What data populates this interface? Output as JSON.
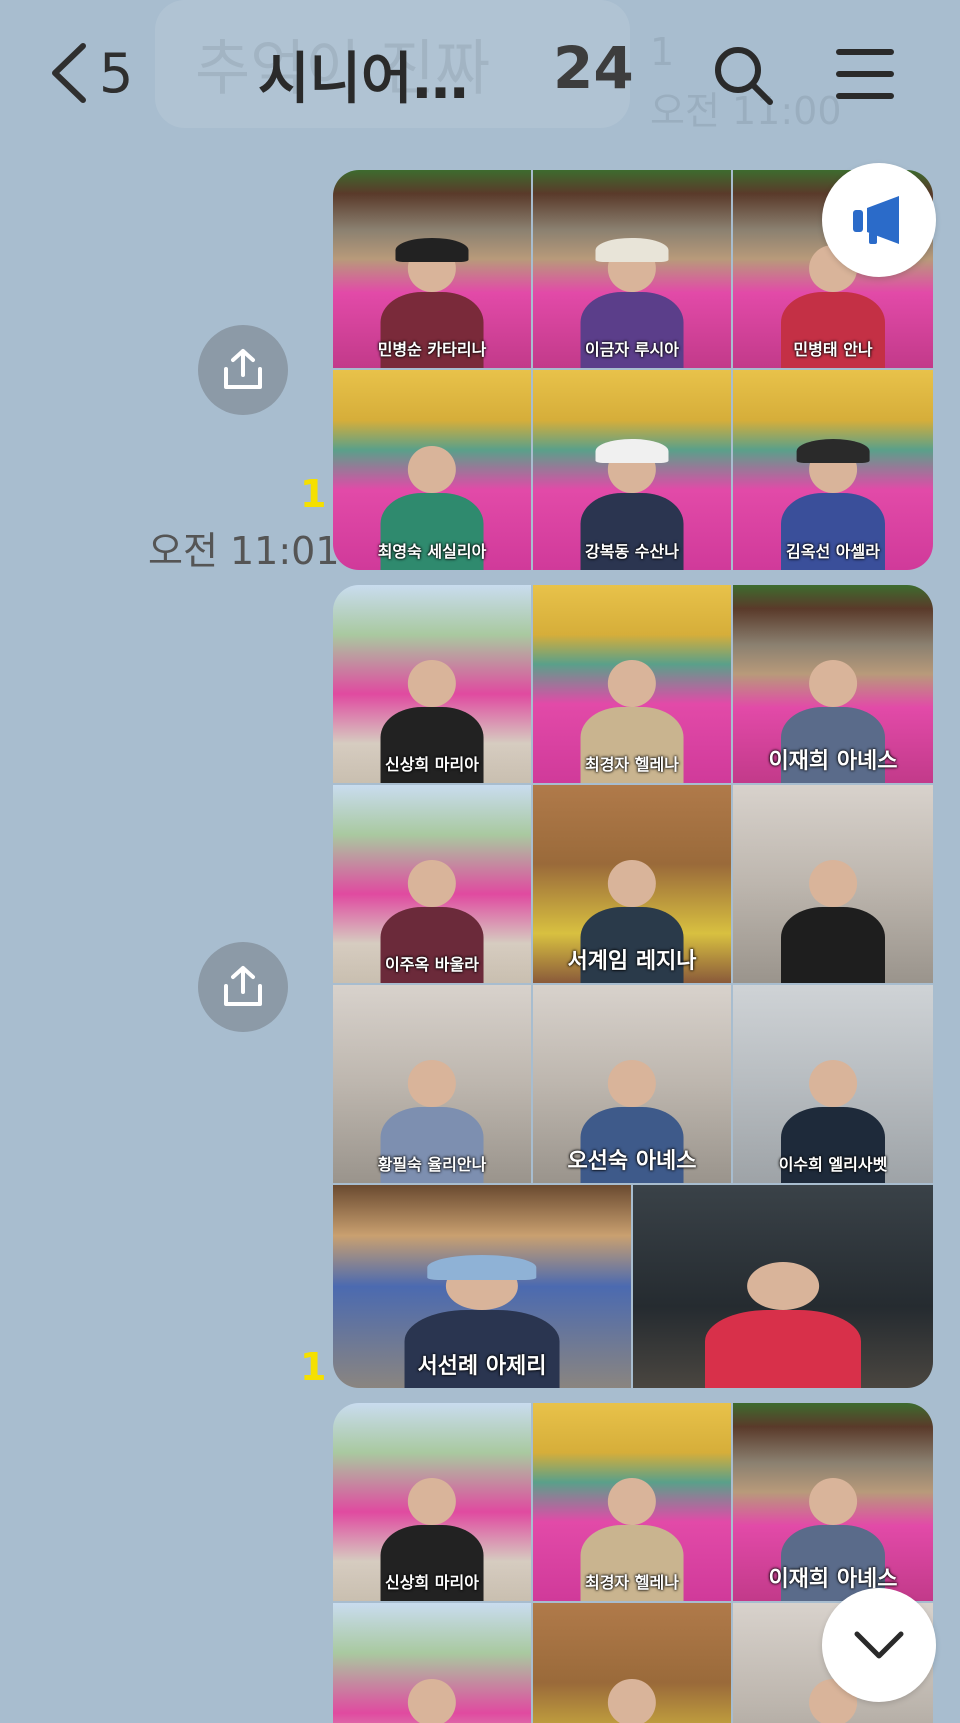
{
  "header": {
    "back_count": "5",
    "title": "시니어…",
    "member_count": "24",
    "ghost_notice_text": "추억이 진짜 ",
    "ghost_notice_time": "오전 11:00",
    "ghost_notice_unread": "1"
  },
  "icons": {
    "back": "chevron-left-icon",
    "search": "search-icon",
    "menu": "hamburger-menu-icon",
    "share": "share-upload-icon",
    "notice": "megaphone-icon",
    "scroll": "chevron-down-icon"
  },
  "colors": {
    "chat_background": "#a8bdcf",
    "unread_badge": "#f5e000",
    "share_button": "#8c9aa7"
  },
  "messages": [
    {
      "unread": "1",
      "time": "오전 11:01",
      "photos": [
        {
          "caption": "민병순 카타리나",
          "scene": "wall",
          "outfit": "#7a2a3a",
          "hat": "#222"
        },
        {
          "caption": "이금자 루시아",
          "scene": "wall",
          "outfit": "#5b3e8a",
          "hat": "#e8e4d8"
        },
        {
          "caption": "민병태 안나",
          "scene": "wall",
          "outfit": "#c43045",
          "hat": ""
        },
        {
          "caption": "최영숙 세실리아",
          "scene": "building",
          "outfit": "#2f8a6e",
          "hat": ""
        },
        {
          "caption": "강복동 수산나",
          "scene": "building",
          "outfit": "#2b3550",
          "hat": "#f0f0f0"
        },
        {
          "caption": "김옥선 아셀라",
          "scene": "building",
          "outfit": "#3a4f9a",
          "hat": "#2a2a2a"
        }
      ]
    },
    {
      "unread": "1",
      "time": "",
      "photos": [
        {
          "caption": "신상희 마리아",
          "scene": "tree",
          "outfit": "#222",
          "hat": ""
        },
        {
          "caption": "최경자 헬레나",
          "scene": "building",
          "outfit": "#c9b48f",
          "hat": ""
        },
        {
          "caption": "이재희 아녜스",
          "scene": "wall",
          "outfit": "#5a6b8a",
          "hat": ""
        },
        {
          "caption": "이주옥 바울라",
          "scene": "tree",
          "outfit": "#6b2a3a",
          "hat": ""
        },
        {
          "caption": "서계임 레지나",
          "scene": "wood",
          "outfit": "#2a3a4a",
          "hat": ""
        },
        {
          "caption": "",
          "scene": "room",
          "outfit": "#1e1e1e",
          "hat": ""
        },
        {
          "caption": "황필숙 율리안나",
          "scene": "room",
          "outfit": "#7d8fb0",
          "hat": ""
        },
        {
          "caption": "오선숙 아녜스",
          "scene": "room",
          "outfit": "#3e5a8a",
          "hat": ""
        },
        {
          "caption": "이수희 엘리사벳",
          "scene": "umbrella",
          "outfit": "#1e2a3a",
          "hat": ""
        },
        {
          "caption": "서선례 아제리",
          "scene": "shop",
          "outfit": "#2a3550",
          "hat": "#8fb2d6"
        },
        {
          "caption": "",
          "scene": "water",
          "outfit": "#d8304a",
          "hat": ""
        }
      ]
    },
    {
      "unread": "",
      "time": "",
      "photos": [
        {
          "caption": "신상희 마리아",
          "scene": "tree",
          "outfit": "#222",
          "hat": ""
        },
        {
          "caption": "최경자 헬레나",
          "scene": "building",
          "outfit": "#c9b48f",
          "hat": ""
        },
        {
          "caption": "이재희 아녜스",
          "scene": "wall",
          "outfit": "#5a6b8a",
          "hat": ""
        },
        {
          "caption": "",
          "scene": "tree",
          "outfit": "#6b2a3a",
          "hat": ""
        },
        {
          "caption": "",
          "scene": "wood",
          "outfit": "#2a3a4a",
          "hat": ""
        },
        {
          "caption": "",
          "scene": "room",
          "outfit": "#1e1e1e",
          "hat": ""
        }
      ]
    }
  ]
}
